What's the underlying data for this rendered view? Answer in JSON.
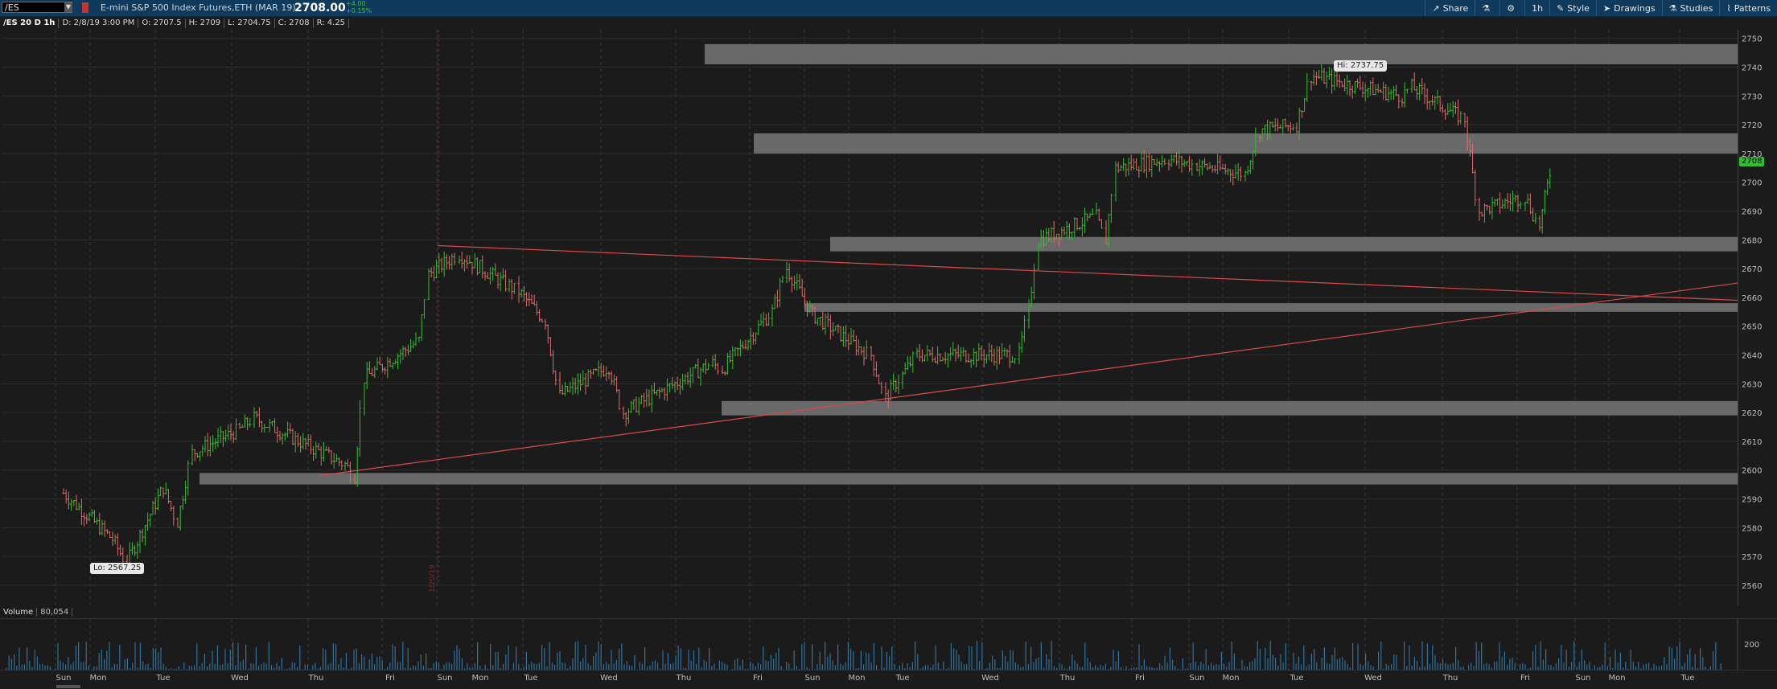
{
  "topbar": {
    "symbol": "/ES",
    "instrument": "E-mini S&P 500 Index Futures,ETH (MAR 19)",
    "last": "2708.00",
    "change_abs": "+4.00",
    "change_pct": "+0.15%",
    "toolbar": [
      {
        "label": "Share",
        "icon": "share-icon"
      },
      {
        "label": "",
        "icon": "flask-icon"
      },
      {
        "label": "",
        "icon": "gear-icon"
      },
      {
        "label": "1h",
        "icon": ""
      },
      {
        "label": "Style",
        "icon": "style-icon"
      },
      {
        "label": "Drawings",
        "icon": "cursor-icon"
      },
      {
        "label": "Studies",
        "icon": "flask-icon"
      },
      {
        "label": "Patterns",
        "icon": "pattern-icon"
      }
    ]
  },
  "subbar": {
    "chart_id": "/ES 20 D 1h",
    "date": "D: 2/8/19 3:00 PM",
    "open": "O: 2707.5",
    "high": "H: 2709",
    "low": "L: 2704.75",
    "close": "C: 2708",
    "range": "R: 4.25"
  },
  "markers": {
    "hi_label": "Hi: 2737.75",
    "lo_label": "Lo: 2567.25",
    "last_tag": "2708",
    "vertical_note": "1/20/19"
  },
  "volume": {
    "label": "Volume",
    "total": "80,054",
    "axis_tick": "200"
  },
  "colors": {
    "background": "#1b1b1b",
    "up_bar": "#2fbf2f",
    "down_bar": "#e06a6a",
    "zone": "#777777",
    "trendline": "#d84a4a",
    "volume_bar": "#2f6f9a"
  },
  "chart_data": {
    "type": "bar",
    "subtype": "ohlc",
    "y_range": [
      2553,
      2753
    ],
    "y_ticks": [
      2560,
      2570,
      2580,
      2590,
      2600,
      2610,
      2620,
      2630,
      2640,
      2650,
      2660,
      2670,
      2680,
      2690,
      2700,
      2710,
      2720,
      2730,
      2740,
      2750
    ],
    "x_tick_labels": [
      "Sun",
      "Mon",
      "Tue",
      "Wed",
      "Thu",
      "Fri",
      "Sun",
      "Mon",
      "Tue",
      "Wed",
      "Thu",
      "Fri",
      "Sun",
      "Mon",
      "Tue",
      "Wed",
      "Thu",
      "Fri",
      "Sun",
      "Mon",
      "Tue",
      "Wed",
      "Thu",
      "Fri",
      "Sun",
      "Mon",
      "Tue"
    ],
    "price_path": [
      [
        "Sun",
        2592
      ],
      [
        "Mon",
        2576
      ],
      [
        "Mon",
        2568
      ],
      [
        "Tue",
        2594
      ],
      [
        "Tue",
        2582
      ],
      [
        "Tue",
        2606
      ],
      [
        "Wed",
        2614
      ],
      [
        "Wed",
        2618
      ],
      [
        "Thu",
        2602
      ],
      [
        "Thu",
        2598
      ],
      [
        "Thu",
        2632
      ],
      [
        "Fri",
        2645
      ],
      [
        "Fri",
        2668
      ],
      [
        "Sun",
        2675
      ],
      [
        "Mon",
        2664
      ],
      [
        "Mon",
        2662
      ],
      [
        "Tue",
        2652
      ],
      [
        "Tue",
        2626
      ],
      [
        "Wed",
        2636
      ],
      [
        "Wed",
        2620
      ],
      [
        "Thu",
        2637
      ],
      [
        "Thu",
        2635
      ],
      [
        "Fri",
        2655
      ],
      [
        "Fri",
        2670
      ],
      [
        "Sun",
        2654
      ],
      [
        "Mon",
        2640
      ],
      [
        "Mon",
        2625
      ],
      [
        "Tue",
        2633
      ],
      [
        "Tue",
        2640
      ],
      [
        "Wed",
        2640
      ],
      [
        "Wed",
        2655
      ],
      [
        "Wed",
        2680
      ],
      [
        "Thu",
        2688
      ],
      [
        "Thu",
        2680
      ],
      [
        "Thu",
        2705
      ],
      [
        "Fri",
        2708
      ],
      [
        "Sun",
        2706
      ],
      [
        "Mon",
        2703
      ],
      [
        "Mon",
        2718
      ],
      [
        "Tue",
        2720
      ],
      [
        "Tue",
        2737
      ],
      [
        "Wed",
        2730
      ],
      [
        "Wed",
        2733
      ],
      [
        "Thu",
        2722
      ],
      [
        "Thu",
        2690
      ],
      [
        "Fri",
        2695
      ],
      [
        "Fri",
        2685
      ],
      [
        "Fri",
        2708
      ]
    ],
    "zones": [
      {
        "from_label": "Fri",
        "y_top": 2748,
        "y_bottom": 2741
      },
      {
        "from_label": "Fri",
        "y_top": 2717,
        "y_bottom": 2710
      },
      {
        "from_label": "Sun",
        "y_top": 2681,
        "y_bottom": 2676
      },
      {
        "from_label": "Sun",
        "y_top": 2658,
        "y_bottom": 2655
      },
      {
        "from_label": "Thu",
        "y_top": 2624,
        "y_bottom": 2619
      },
      {
        "from_label": "Tue",
        "y_top": 2599,
        "y_bottom": 2595
      }
    ],
    "trendlines": [
      {
        "from": [
          "Sun",
          2678
        ],
        "to": [
          "end",
          2659
        ]
      },
      {
        "from": [
          "Thu",
          2598
        ],
        "to": [
          "end",
          2665
        ]
      }
    ],
    "volume_axis_tick": 200
  }
}
